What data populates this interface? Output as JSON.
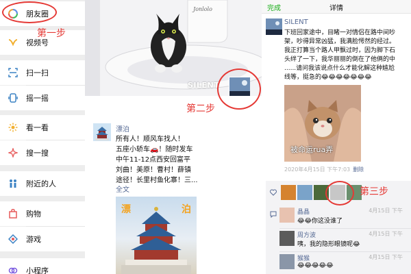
{
  "panel1": {
    "items": [
      {
        "label": "朋友圈",
        "icon": "moments-icon"
      },
      {
        "label": "视频号",
        "icon": "channels-icon"
      },
      {
        "label": "扫一扫",
        "icon": "scan-icon"
      },
      {
        "label": "摇一摇",
        "icon": "shake-icon"
      },
      {
        "label": "看一看",
        "icon": "top-stories-icon"
      },
      {
        "label": "搜一搜",
        "icon": "search-icon"
      },
      {
        "label": "附近的人",
        "icon": "people-nearby-icon"
      },
      {
        "label": "购物",
        "icon": "shopping-icon"
      },
      {
        "label": "游戏",
        "icon": "games-icon"
      },
      {
        "label": "小程序",
        "icon": "mini-programs-icon"
      }
    ],
    "step_label": "第一步"
  },
  "panel2": {
    "cover_name": "SILENT",
    "step_label": "第二步",
    "post": {
      "name": "漂泊",
      "lines": [
        "所有人！顺风车找人！",
        "五座小轿车🚗！随时发车",
        "中午11-12点西安回富平",
        "刘曲！美原！曹村！薛镇",
        "途径！长里村鱼化寨！三..."
      ],
      "full_text": "全文",
      "image_caption_left": "漂",
      "image_caption_right": "泊"
    }
  },
  "panel3": {
    "done": "完成",
    "title": "详情",
    "name": "SILENT",
    "lines": [
      "下班回家途中，目睹一对情侣在路中间吵",
      "架，吵得异常凶猛，我满脸愕然的经过。",
      "我正打算当个路人甲飘过时，因为脚下石",
      "头绊了一下，我华丽丽的倒在了他俩的中",
      "......请问我该说点什么才能化解这种尴尬",
      "线等，挺急的😂😂😂😂😂😂😂"
    ],
    "photo_caption": "被命运rua弄",
    "time": "2020年4月15日 下午7:03",
    "delete": "删除",
    "step_label": "第三步",
    "comments": [
      {
        "name": "晶晶",
        "text": "😂😂你这没谁了",
        "date": "4月15日 下午"
      },
      {
        "name": "周方波",
        "text": "咦，我的隐形眼镜呢😂",
        "date": "4月15日 下午"
      },
      {
        "name": "猴猴",
        "text": "😂😂😂😂😂",
        "date": "4月15日 下午"
      }
    ]
  },
  "colors": {
    "step_red": "#e53935",
    "link_blue": "#576b95",
    "done_green": "#1aad19"
  }
}
